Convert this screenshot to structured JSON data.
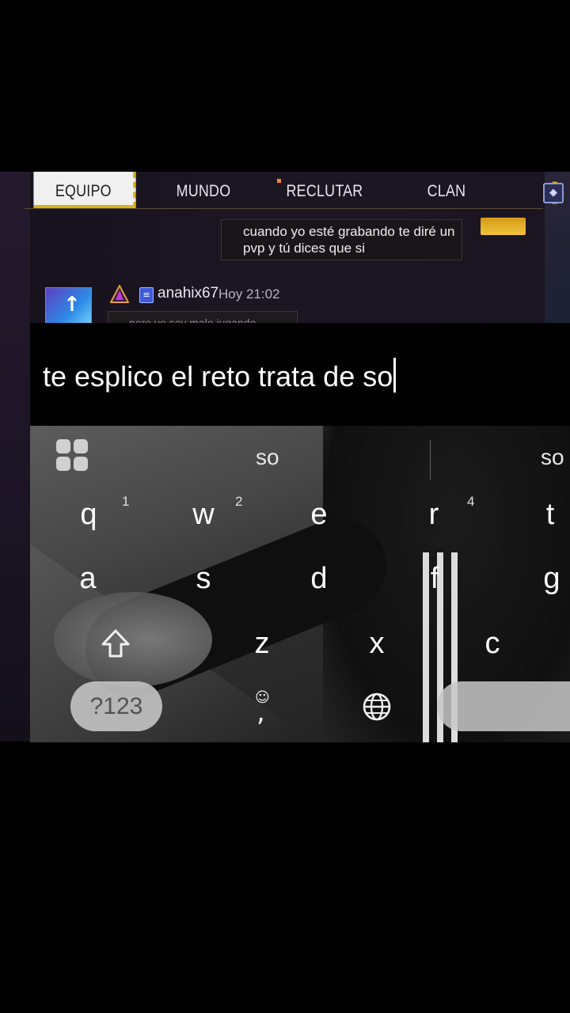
{
  "tabs": [
    {
      "label": "EQUIPO",
      "active": true
    },
    {
      "label": "MUNDO",
      "active": false
    },
    {
      "label": "RECLUTAR",
      "active": false
    },
    {
      "label": "CLAN",
      "active": false
    }
  ],
  "chat": {
    "bubble_own": "cuando yo esté grabando te diré un pvp y tú dices que si",
    "user": "anahix67",
    "time": "Hoy 21:02",
    "bubble_other_partial": "pero yo soy malo jugando"
  },
  "input": {
    "text": "te esplico el reto trata de so"
  },
  "keyboard": {
    "suggestions": [
      "so",
      "so"
    ],
    "row1": [
      {
        "k": "q",
        "hint": "1"
      },
      {
        "k": "w",
        "hint": "2"
      },
      {
        "k": "e",
        "hint": ""
      },
      {
        "k": "r",
        "hint": "4"
      },
      {
        "k": "t",
        "hint": ""
      }
    ],
    "row2": [
      "a",
      "s",
      "d",
      "f",
      "g"
    ],
    "row3": [
      "z",
      "x",
      "c"
    ],
    "sym_label": "?123",
    "comma": ","
  },
  "colors": {
    "tab_active_bg": "#f0f0f0",
    "tab_accent": "#d8b21a",
    "chevron": "#f2b21b"
  }
}
